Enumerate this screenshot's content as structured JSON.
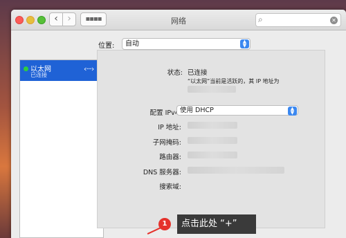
{
  "window": {
    "title": "网络",
    "nav_back": "‹",
    "nav_forward": "›",
    "grid_icon": "grid-icon"
  },
  "search": {
    "value": "",
    "clear_icon": "clear-icon"
  },
  "location": {
    "label": "位置:",
    "value": "自动"
  },
  "sidebar": {
    "services": [
      {
        "name": "以太网",
        "status": "已连接",
        "status_color": "#2ecc40",
        "icon": "ethernet-icon"
      }
    ]
  },
  "detail": {
    "status_label": "状态:",
    "status_value": "已连接",
    "status_note": "“以太网”当前是活跃的，其 IP 地址为",
    "configure_label": "配置 IPv4:",
    "configure_value": "使用 DHCP",
    "ip_label": "IP 地址:",
    "subnet_label": "子网掩码:",
    "router_label": "路由器:",
    "dns_label": "DNS 服务器:",
    "search_domain_label": "搜索域:"
  },
  "annotation": {
    "badge": "1",
    "text": "点击此处 “+”",
    "color": "#e5322c"
  }
}
